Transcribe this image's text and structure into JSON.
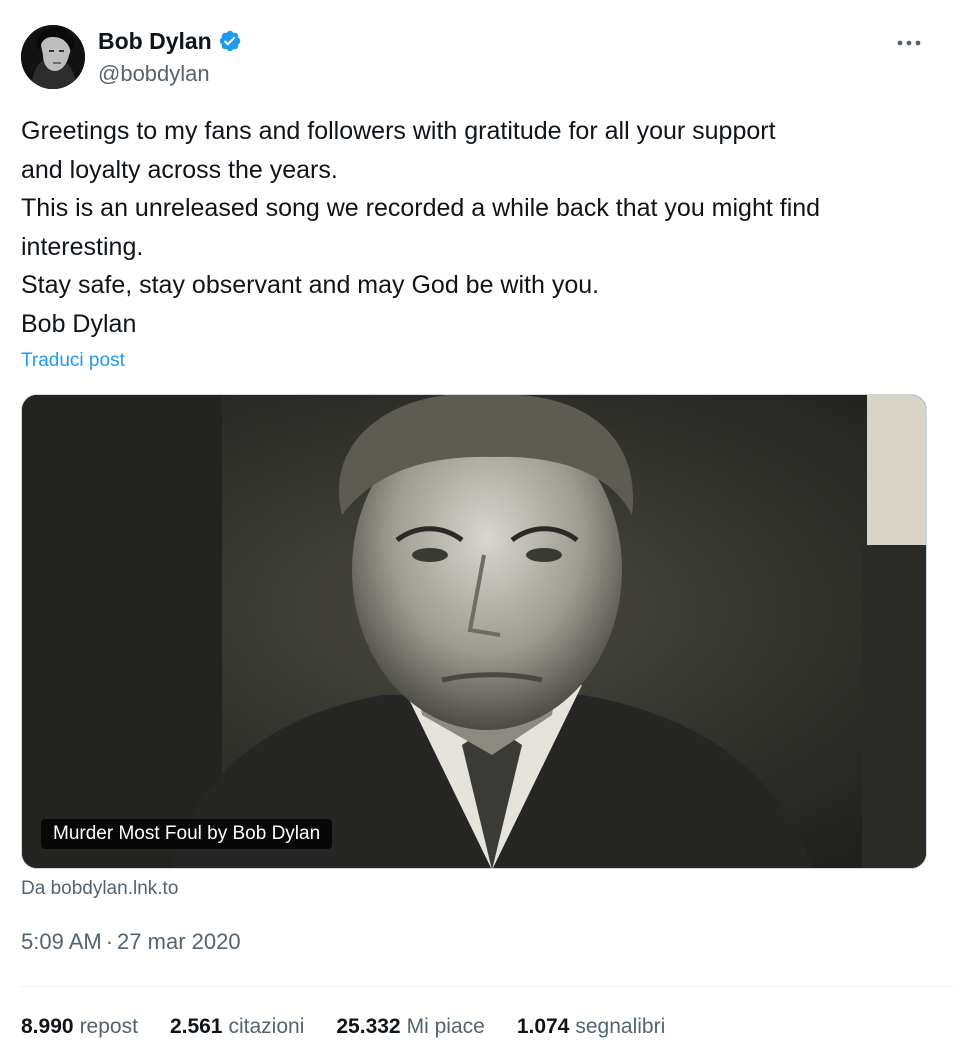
{
  "author": {
    "display_name": "Bob Dylan",
    "handle": "@bobdylan",
    "verified": true,
    "verified_color": "#1d9bf0"
  },
  "tweet": {
    "lines": [
      "Greetings to my fans and followers with gratitude for all your support",
      "and loyalty across the years.",
      "This is an unreleased song we recorded a while back that you might find",
      "interesting.",
      "Stay safe, stay observant and may God be with you.",
      "Bob Dylan"
    ],
    "translate_label": "Traduci post"
  },
  "media": {
    "caption": "Murder Most Foul by Bob Dylan",
    "source": "Da bobdylan.lnk.to"
  },
  "timestamp": {
    "time": "5:09 AM",
    "separator": "·",
    "date": "27 mar 2020"
  },
  "stats": [
    {
      "count": "8.990",
      "label": "repost"
    },
    {
      "count": "2.561",
      "label": "citazioni"
    },
    {
      "count": "25.332",
      "label": "Mi piace"
    },
    {
      "count": "1.074",
      "label": "segnalibri"
    }
  ],
  "colors": {
    "link": "#1d9bf0",
    "secondary_text": "#536471",
    "primary_text": "#0f1419"
  },
  "icons": {
    "verified": "verified-badge-icon",
    "more": "more-options-icon"
  }
}
